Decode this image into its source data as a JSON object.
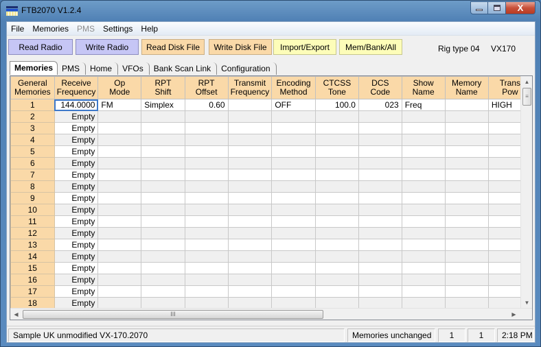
{
  "window": {
    "title": "FTB2070 V1.2.4",
    "controls": {
      "minimize": "minimize",
      "maximize": "maximize",
      "close": "X"
    }
  },
  "menu": [
    {
      "label": "File",
      "enabled": true
    },
    {
      "label": "Memories",
      "enabled": true
    },
    {
      "label": "PMS",
      "enabled": false
    },
    {
      "label": "Settings",
      "enabled": true
    },
    {
      "label": "Help",
      "enabled": true
    }
  ],
  "toolbar": {
    "buttons": [
      {
        "label": "Read Radio",
        "color": "#c6c6f5"
      },
      {
        "label": "Write Radio",
        "color": "#c6c6f5"
      },
      {
        "label": "Read Disk File",
        "color": "#fad9a8"
      },
      {
        "label": "Write Disk File",
        "color": "#fad9a8"
      },
      {
        "label": "Import/Export",
        "color": "#fdfdb9"
      },
      {
        "label": "Mem/Bank/All",
        "color": "#fdfdb9"
      }
    ],
    "rig_type": "Rig type 04",
    "model": "VX170"
  },
  "tabs": [
    {
      "label": "Memories",
      "active": true
    },
    {
      "label": "PMS",
      "active": false
    },
    {
      "label": "Home",
      "active": false
    },
    {
      "label": "VFOs",
      "active": false
    },
    {
      "label": "Bank Scan Link",
      "active": false
    },
    {
      "label": "Configuration",
      "active": false
    }
  ],
  "grid": {
    "columns": [
      {
        "line1": "General",
        "line2": "Memories"
      },
      {
        "line1": "Receive",
        "line2": "Frequency"
      },
      {
        "line1": "Op",
        "line2": "Mode"
      },
      {
        "line1": "RPT",
        "line2": "Shift"
      },
      {
        "line1": "RPT",
        "line2": "Offset"
      },
      {
        "line1": "Transmit",
        "line2": "Frequency"
      },
      {
        "line1": "Encoding",
        "line2": "Method"
      },
      {
        "line1": "CTCSS",
        "line2": "Tone"
      },
      {
        "line1": "DCS",
        "line2": "Code"
      },
      {
        "line1": "Show",
        "line2": "Name"
      },
      {
        "line1": "Memory",
        "line2": "Name"
      },
      {
        "line1": "Trans",
        "line2": "Pow"
      }
    ],
    "rows": [
      [
        "1",
        "144.0000",
        "FM",
        "Simplex",
        "0.60",
        "",
        "OFF",
        "100.0",
        "023",
        "Freq",
        "",
        "HIGH"
      ],
      [
        "2",
        "Empty",
        "",
        "",
        "",
        "",
        "",
        "",
        "",
        "",
        "",
        ""
      ],
      [
        "3",
        "Empty",
        "",
        "",
        "",
        "",
        "",
        "",
        "",
        "",
        "",
        ""
      ],
      [
        "4",
        "Empty",
        "",
        "",
        "",
        "",
        "",
        "",
        "",
        "",
        "",
        ""
      ],
      [
        "5",
        "Empty",
        "",
        "",
        "",
        "",
        "",
        "",
        "",
        "",
        "",
        ""
      ],
      [
        "6",
        "Empty",
        "",
        "",
        "",
        "",
        "",
        "",
        "",
        "",
        "",
        ""
      ],
      [
        "7",
        "Empty",
        "",
        "",
        "",
        "",
        "",
        "",
        "",
        "",
        "",
        ""
      ],
      [
        "8",
        "Empty",
        "",
        "",
        "",
        "",
        "",
        "",
        "",
        "",
        "",
        ""
      ],
      [
        "9",
        "Empty",
        "",
        "",
        "",
        "",
        "",
        "",
        "",
        "",
        "",
        ""
      ],
      [
        "10",
        "Empty",
        "",
        "",
        "",
        "",
        "",
        "",
        "",
        "",
        "",
        ""
      ],
      [
        "11",
        "Empty",
        "",
        "",
        "",
        "",
        "",
        "",
        "",
        "",
        "",
        ""
      ],
      [
        "12",
        "Empty",
        "",
        "",
        "",
        "",
        "",
        "",
        "",
        "",
        "",
        ""
      ],
      [
        "13",
        "Empty",
        "",
        "",
        "",
        "",
        "",
        "",
        "",
        "",
        "",
        ""
      ],
      [
        "14",
        "Empty",
        "",
        "",
        "",
        "",
        "",
        "",
        "",
        "",
        "",
        ""
      ],
      [
        "15",
        "Empty",
        "",
        "",
        "",
        "",
        "",
        "",
        "",
        "",
        "",
        ""
      ],
      [
        "16",
        "Empty",
        "",
        "",
        "",
        "",
        "",
        "",
        "",
        "",
        "",
        ""
      ],
      [
        "17",
        "Empty",
        "",
        "",
        "",
        "",
        "",
        "",
        "",
        "",
        "",
        ""
      ],
      [
        "18",
        "Empty",
        "",
        "",
        "",
        "",
        "",
        "",
        "",
        "",
        "",
        ""
      ]
    ],
    "selected_cell": {
      "row": 0,
      "col": 1
    }
  },
  "scrollbars": {
    "grip_glyph": "III",
    "vgrip_glyph": "≡"
  },
  "status": {
    "file": "Sample UK unmodified VX-170.2070",
    "state": "Memories unchanged",
    "field1": "1",
    "field2": "1",
    "time": "2:18 PM"
  }
}
